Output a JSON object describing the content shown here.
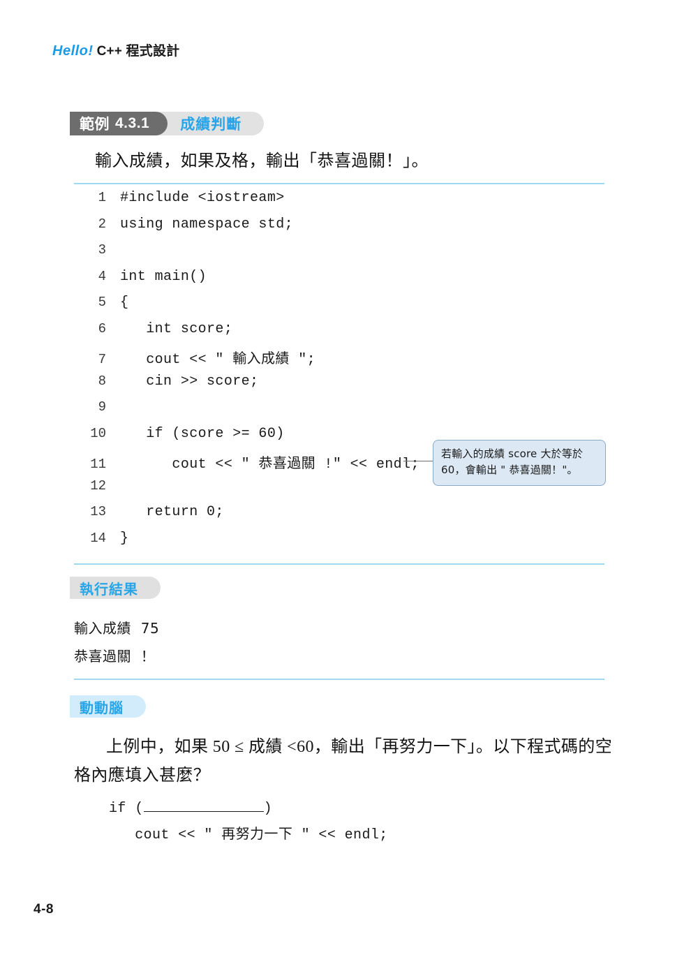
{
  "header": {
    "brand": "Hello!",
    "title": "C++ 程式設計"
  },
  "example": {
    "label": "範例",
    "number": "4.3.1",
    "caption": "成績判斷",
    "description": "輸入成績，如果及格，輸出「恭喜過關！」。"
  },
  "code": {
    "lines": [
      {
        "no": "1",
        "text": "#include <iostream>"
      },
      {
        "no": "2",
        "text": "using namespace std;"
      },
      {
        "no": "3",
        "text": ""
      },
      {
        "no": "4",
        "text": "int main()"
      },
      {
        "no": "5",
        "text": "{"
      },
      {
        "no": "6",
        "text": "   int score;"
      },
      {
        "no": "7",
        "text": "   cout << \" 輸入成績 \";"
      },
      {
        "no": "8",
        "text": "   cin >> score;"
      },
      {
        "no": "9",
        "text": ""
      },
      {
        "no": "10",
        "text": "   if (score >= 60)"
      },
      {
        "no": "11",
        "text": "      cout << \" 恭喜過關 !\" << endl;"
      },
      {
        "no": "12",
        "text": ""
      },
      {
        "no": "13",
        "text": "   return 0;"
      },
      {
        "no": "14",
        "text": "}"
      }
    ]
  },
  "callout": {
    "text": "若輸入的成績 score 大於等於 60，會輸出 \" 恭喜過關！\"。"
  },
  "result": {
    "pill_label": "執行結果",
    "lines": [
      "輸入成績  75",
      "恭喜過關  ！"
    ]
  },
  "exercise": {
    "pill_label": "動動腦",
    "question": "上例中，如果 50 ≤ 成績 <60，輸出「再努力一下」。以下程式碼的空格內應填入甚麼？",
    "code_prefix": "if (",
    "code_suffix": ")",
    "code_line2": "   cout << \" 再努力一下 \" << endl;"
  },
  "folio": "4-8",
  "colors": {
    "brand_blue": "#1b9ae8",
    "accent_blue": "#28a5e8",
    "rule_blue": "#9fd9f0",
    "pill_dark": "#6d6d6d",
    "pill_gray": "#e0e0e0",
    "pill_lightblue": "#d3ecfb",
    "callout_bg": "#dce8f3",
    "callout_border": "#8aa9c4"
  }
}
